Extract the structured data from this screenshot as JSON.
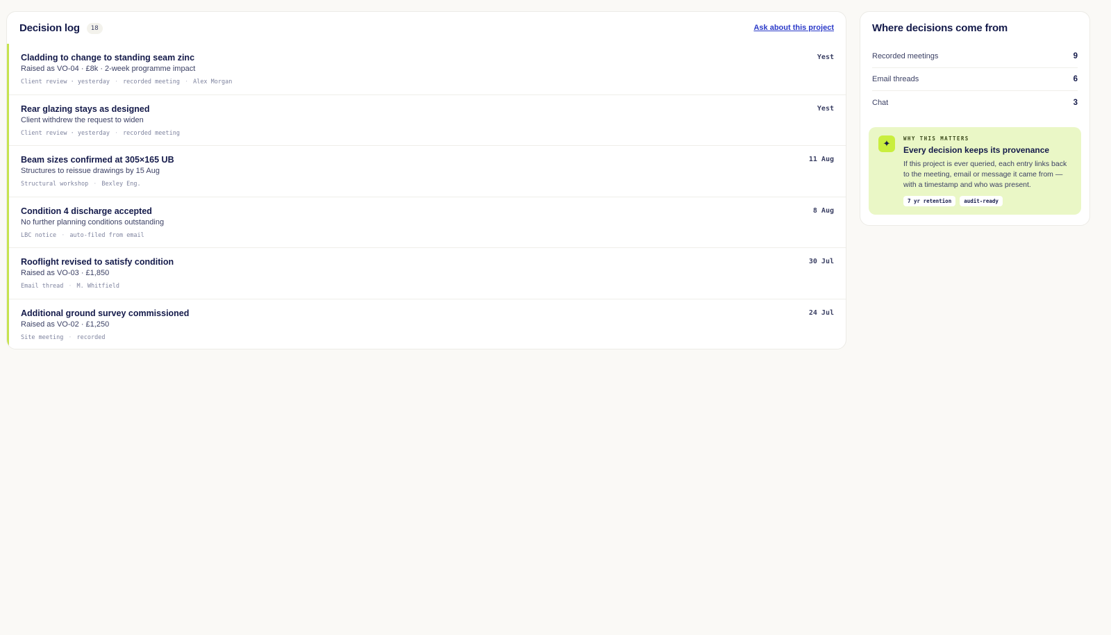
{
  "log": {
    "title": "Decision log",
    "count": "18",
    "ask_link": "Ask about this project",
    "entries": [
      {
        "title": "Cladding to change to standing seam zinc",
        "desc": "Raised as VO-04 · £8k · 2-week programme impact",
        "meta": [
          "Client review · yesterday",
          "recorded meeting",
          "Alex Morgan"
        ],
        "date": "Yest"
      },
      {
        "title": "Rear glazing stays as designed",
        "desc": "Client withdrew the request to widen",
        "meta": [
          "Client review · yesterday",
          "recorded meeting"
        ],
        "date": "Yest"
      },
      {
        "title": "Beam sizes confirmed at 305×165 UB",
        "desc": "Structures to reissue drawings by 15 Aug",
        "meta": [
          "Structural workshop",
          "Bexley Eng."
        ],
        "date": "11 Aug"
      },
      {
        "title": "Condition 4 discharge accepted",
        "desc": "No further planning conditions outstanding",
        "meta": [
          "LBC notice",
          "auto-filed from email"
        ],
        "date": "8 Aug"
      },
      {
        "title": "Rooflight revised to satisfy condition",
        "desc": "Raised as VO-03 · £1,850",
        "meta": [
          "Email thread",
          "M. Whitfield"
        ],
        "date": "30 Jul"
      },
      {
        "title": "Additional ground survey commissioned",
        "desc": "Raised as VO-02 · £1,250",
        "meta": [
          "Site meeting",
          "recorded"
        ],
        "date": "24 Jul"
      }
    ]
  },
  "sources": {
    "title": "Where decisions come from",
    "rows": [
      {
        "label": "Recorded meetings",
        "value": "9"
      },
      {
        "label": "Email threads",
        "value": "6"
      },
      {
        "label": "Chat",
        "value": "3"
      }
    ]
  },
  "why": {
    "icon": "sparkle-icon",
    "eyebrow": "WHY THIS MATTERS",
    "title": "Every decision keeps its provenance",
    "text": "If this project is ever queried, each entry links back to the meeting, email or message it came from — with a timestamp and who was present.",
    "tags": [
      "7 yr retention",
      "audit-ready"
    ]
  },
  "colors": {
    "accent": "#c6e34f",
    "link": "#2a39c8",
    "ink": "#141a4a",
    "why_bg": "#eaf7c6"
  }
}
